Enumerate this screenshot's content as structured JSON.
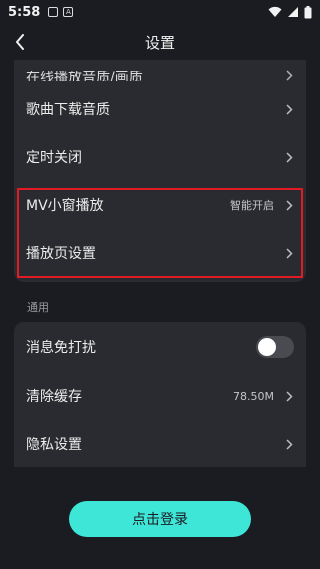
{
  "status_bar": {
    "time": "5:58",
    "notif_icon_a": "A"
  },
  "header": {
    "title": "设置"
  },
  "playback_card": {
    "items": [
      {
        "label": "在线播放音质/画质",
        "value": ""
      },
      {
        "label": "歌曲下载音质",
        "value": ""
      },
      {
        "label": "定时关闭",
        "value": ""
      },
      {
        "label": "MV小窗播放",
        "value": "智能开启"
      },
      {
        "label": "播放页设置",
        "value": ""
      }
    ]
  },
  "general": {
    "section_label": "通用",
    "items": [
      {
        "label": "消息免打扰",
        "toggle": false
      },
      {
        "label": "清除缓存",
        "value": "78.50M"
      },
      {
        "label": "隐私设置",
        "value": ""
      }
    ]
  },
  "login_button": {
    "label": "点击登录"
  },
  "colors": {
    "background": "#1b1c21",
    "card": "#2a2b30",
    "accent": "#3ee6d8",
    "highlight_border": "#e01b24"
  },
  "icons": [
    "back-arrow-icon",
    "chevron-right-icon",
    "wifi-icon",
    "signal-icon",
    "battery-icon"
  ]
}
